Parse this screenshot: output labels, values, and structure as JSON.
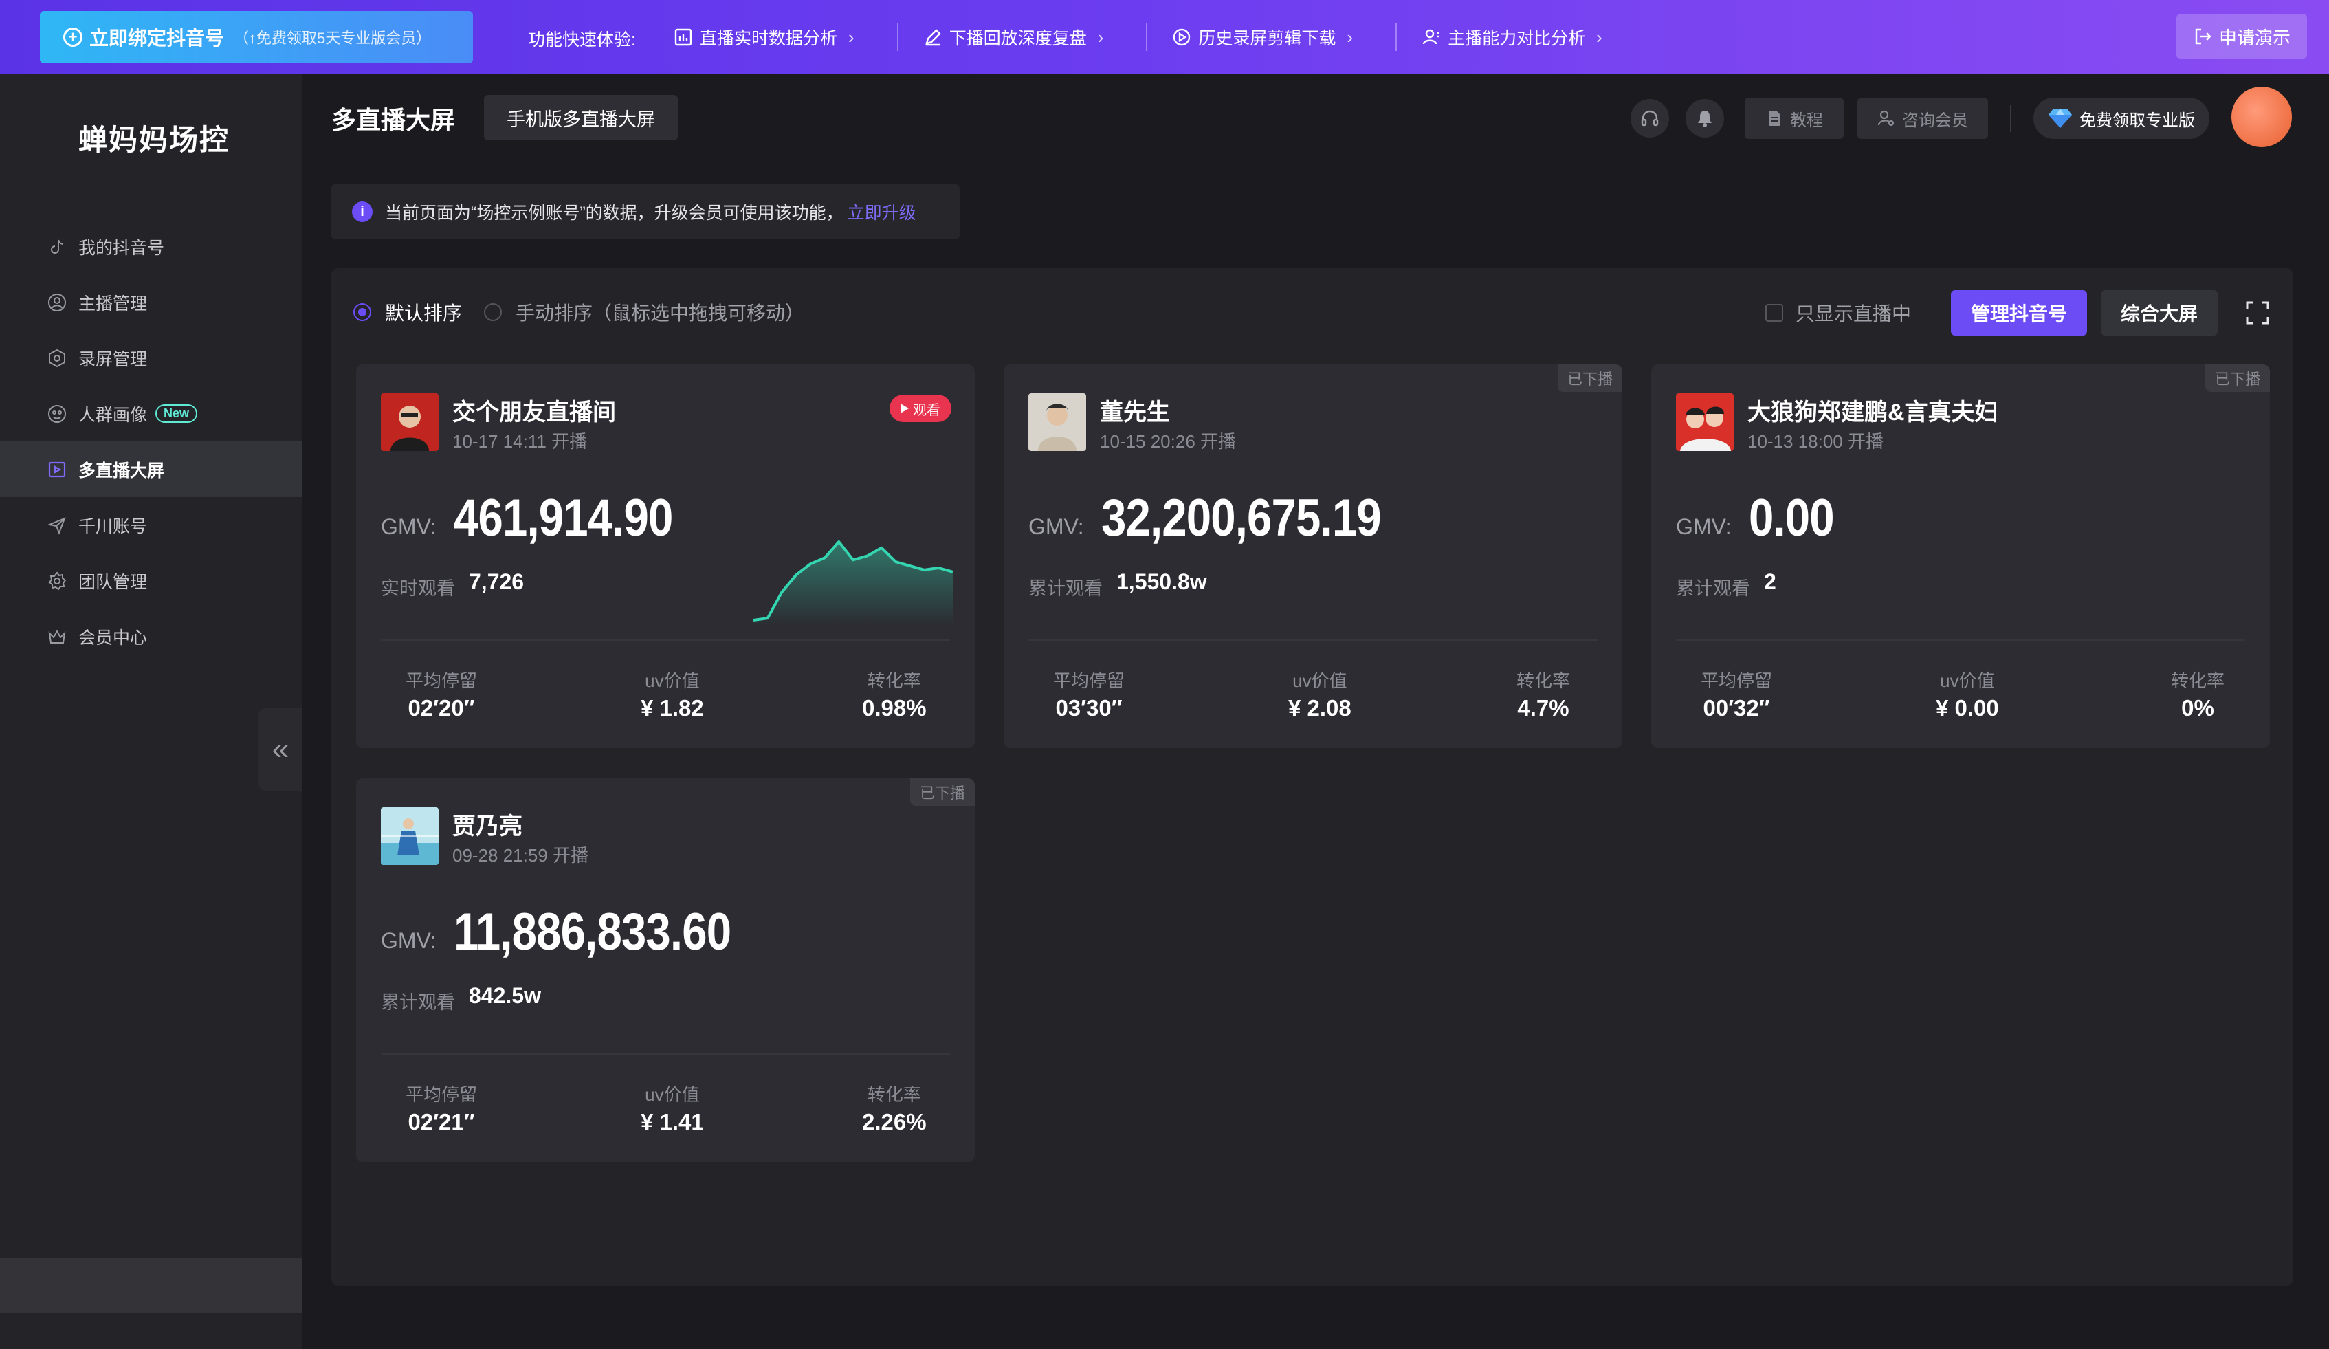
{
  "topbar": {
    "bind_label": "立即绑定抖音号",
    "bind_sub": "（↑免费领取5天专业版会员）",
    "quick_label": "功能快速体验:",
    "quick_items": [
      {
        "label": "直播实时数据分析",
        "icon": "bar-chart-icon"
      },
      {
        "label": "下播回放深度复盘",
        "icon": "pencil-icon"
      },
      {
        "label": "历史录屏剪辑下载",
        "icon": "play-circle-icon"
      },
      {
        "label": "主播能力对比分析",
        "icon": "user-compare-icon"
      }
    ],
    "demo_label": "申请演示"
  },
  "sidebar": {
    "logo": "蝉妈妈场控",
    "items": [
      {
        "label": "我的抖音号",
        "icon": "tiktok-icon"
      },
      {
        "label": "主播管理",
        "icon": "user-circle-icon"
      },
      {
        "label": "录屏管理",
        "icon": "record-icon"
      },
      {
        "label": "人群画像",
        "icon": "persona-icon",
        "badge": "New"
      },
      {
        "label": "多直播大屏",
        "icon": "screen-icon",
        "active": true
      },
      {
        "label": "千川账号",
        "icon": "send-icon"
      },
      {
        "label": "团队管理",
        "icon": "gear-icon"
      },
      {
        "label": "会员中心",
        "icon": "crown-icon"
      }
    ]
  },
  "header": {
    "title": "多直播大屏",
    "mobile_btn": "手机版多直播大屏",
    "tutorial": "教程",
    "consult": "咨询会员",
    "pro": "免费领取专业版"
  },
  "notice": {
    "text": "当前页面为“场控示例账号”的数据，升级会员可使用该功能，",
    "link": "立即升级"
  },
  "controls": {
    "sort_default": "默认排序",
    "sort_manual": "手动排序（鼠标选中拖拽可移动）",
    "only_live": "只显示直播中",
    "manage_btn": "管理抖音号",
    "overview_btn": "综合大屏"
  },
  "labels": {
    "gmv": "GMV:",
    "avg_stay": "平均停留",
    "uv_value": "uv价值",
    "conversion": "转化率",
    "live_badge": "观看",
    "offline_badge": "已下播"
  },
  "cards": [
    {
      "name": "交个朋友直播间",
      "time": "10-17 14:11 开播",
      "live": true,
      "gmv": "461,914.90",
      "view_label": "实时观看",
      "view_value": "7,726",
      "avg_stay": "02′20″",
      "uv_value": "¥ 1.82",
      "conversion": "0.98%",
      "trend": [
        0,
        2,
        28,
        45,
        56,
        62,
        78,
        60,
        64,
        72,
        58,
        54,
        50,
        52,
        48
      ]
    },
    {
      "name": "董先生",
      "time": "10-15 20:26 开播",
      "live": false,
      "gmv": "32,200,675.19",
      "view_label": "累计观看",
      "view_value": "1,550.8w",
      "avg_stay": "03′30″",
      "uv_value": "¥ 2.08",
      "conversion": "4.7%"
    },
    {
      "name": "大狼狗郑建鹏&言真夫妇",
      "time": "10-13 18:00 开播",
      "live": false,
      "gmv": "0.00",
      "view_label": "累计观看",
      "view_value": "2",
      "avg_stay": "00′32″",
      "uv_value": "¥ 0.00",
      "conversion": "0%"
    },
    {
      "name": "贾乃亮",
      "time": "09-28 21:59 开播",
      "live": false,
      "gmv": "11,886,833.60",
      "view_label": "累计观看",
      "view_value": "842.5w",
      "avg_stay": "02′21″",
      "uv_value": "¥ 1.41",
      "conversion": "2.26%"
    }
  ],
  "colors": {
    "accent": "#6b4cf5",
    "sparkline": "#34d5b0",
    "live": "#e8344e"
  }
}
